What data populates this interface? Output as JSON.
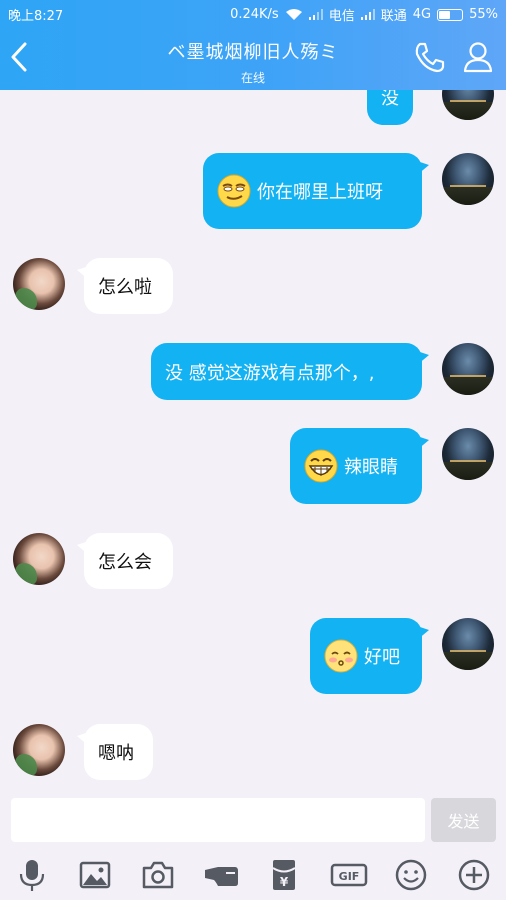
{
  "statusbar": {
    "time": "晚上8:27",
    "speed": "0.24K/s",
    "carrier1": "电信",
    "carrier2": "联通",
    "network": "4G",
    "battery_percent": "55%",
    "battery_level": 0.55
  },
  "header": {
    "title": "ベ墨城烟柳旧人殇ミ",
    "subtitle": "在线"
  },
  "messages": [
    {
      "side": "out",
      "text": "没",
      "emoji": null
    },
    {
      "side": "out",
      "text": "你在哪里上班呀",
      "emoji": "smirk-emoji"
    },
    {
      "side": "in",
      "text": "怎么啦",
      "emoji": null
    },
    {
      "side": "out",
      "text": "没 感觉这游戏有点那个，,",
      "emoji": null
    },
    {
      "side": "out",
      "text": "辣眼睛",
      "emoji": "grin-emoji"
    },
    {
      "side": "in",
      "text": "怎么会",
      "emoji": null
    },
    {
      "side": "out",
      "text": "好吧",
      "emoji": "blush-emoji"
    },
    {
      "side": "in",
      "text": "嗯呐",
      "emoji": null
    }
  ],
  "input": {
    "value": "",
    "send_label": "发送"
  },
  "toolbar": {
    "icons": [
      "microphone-icon",
      "image-icon",
      "camera-icon",
      "poke-icon",
      "red-packet-icon",
      "gif-icon",
      "emoji-icon",
      "plus-icon"
    ],
    "gif_label": "GIF",
    "yen_label": "¥"
  },
  "colors": {
    "header": "#3fa3f7",
    "bubble_out": "#13b2f3",
    "bubble_in": "#ffffff",
    "background": "#f3f0f8"
  }
}
